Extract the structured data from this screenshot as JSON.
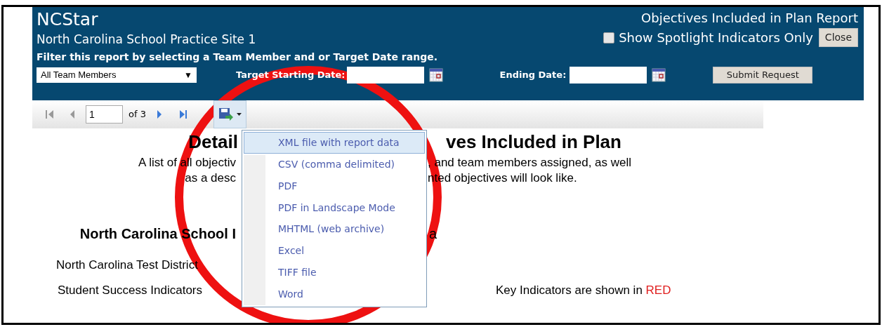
{
  "header": {
    "app_title": "NCStar",
    "site": "North Carolina School Practice Site 1",
    "instructions": "Filter this report by selecting a Team Member and or Target Date range.",
    "report_title": "Objectives Included in Plan Report",
    "spotlight": {
      "label": "Show Spotlight Indicators Only",
      "checked": false
    },
    "close_button": "Close",
    "team_select": {
      "value": "All Team Members",
      "arrow": "▼"
    },
    "start_date": {
      "label": "Target Starting Date:"
    },
    "end_date": {
      "label": "Ending Date:"
    },
    "submit_button": "Submit Request"
  },
  "toolbar": {
    "page": "1",
    "page_count": "of 3"
  },
  "export_menu": {
    "expanded": true,
    "items": [
      {
        "label": "XML file with report data",
        "selected": true
      },
      {
        "label": "CSV (comma delimited)",
        "selected": false
      },
      {
        "label": "PDF",
        "selected": false
      },
      {
        "label": "PDF in Landscape Mode",
        "selected": false
      },
      {
        "label": "MHTML (web archive)",
        "selected": false
      },
      {
        "label": "Excel",
        "selected": false
      },
      {
        "label": "TIFF file",
        "selected": false
      },
      {
        "label": "Word",
        "selected": false
      }
    ]
  },
  "report": {
    "title": {
      "left": "Detail",
      "right": "ves Included in Plan"
    },
    "description": [
      {
        "left": "A list of all objectiv",
        "right": ", and team members assigned, as well"
      },
      {
        "left": "as a desc",
        "right": "nted objectives will look like."
      }
    ],
    "school": {
      "left": "North Carolina School I",
      "right": "a"
    },
    "district": "North Carolina Test District",
    "section": "Student Success Indicators",
    "key_note": {
      "text": "Key Indicators are shown in ",
      "highlight": "RED"
    }
  }
}
